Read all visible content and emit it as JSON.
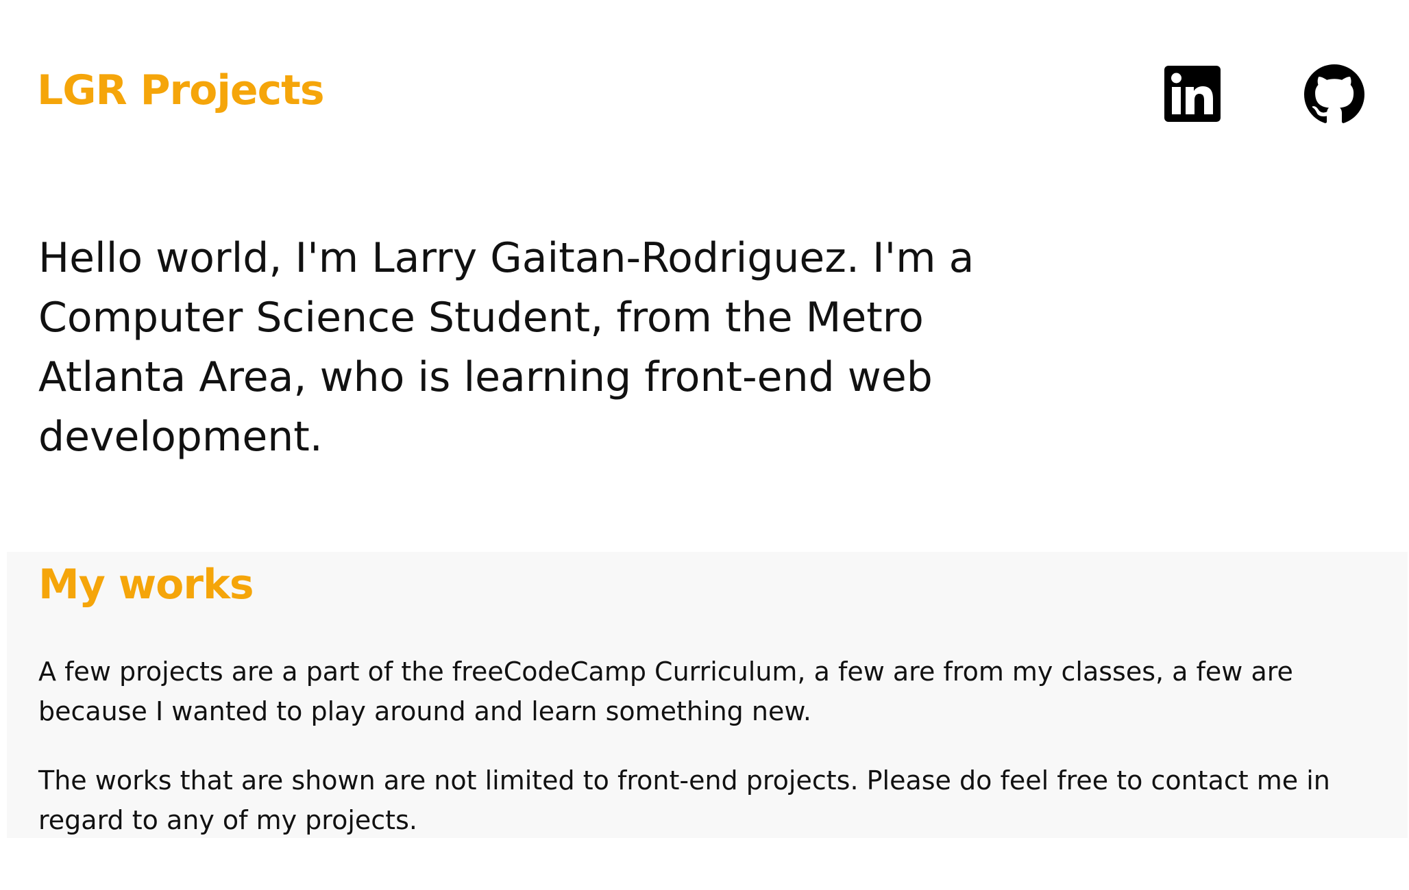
{
  "header": {
    "title": "LGR Projects",
    "social": [
      {
        "name": "LinkedIn",
        "icon": "linkedin-icon"
      },
      {
        "name": "GitHub",
        "icon": "github-icon"
      }
    ]
  },
  "intro": {
    "text": "Hello world, I'm Larry Gaitan-Rodriguez. I'm a Computer Science Student, from the Metro Atlanta Area, who is learning front-end web development."
  },
  "works": {
    "title": "My works",
    "paragraphs": [
      "A few projects are a part of the freeCodeCamp Curriculum, a few are from my classes, a few are because I wanted to play around and learn something new.",
      "The works that are shown are not limited to front-end projects. Please do feel free to contact me in regard to any of my projects."
    ]
  },
  "colors": {
    "accent": "#f5a50a",
    "text": "#111111",
    "section_bg": "#f8f8f8"
  }
}
